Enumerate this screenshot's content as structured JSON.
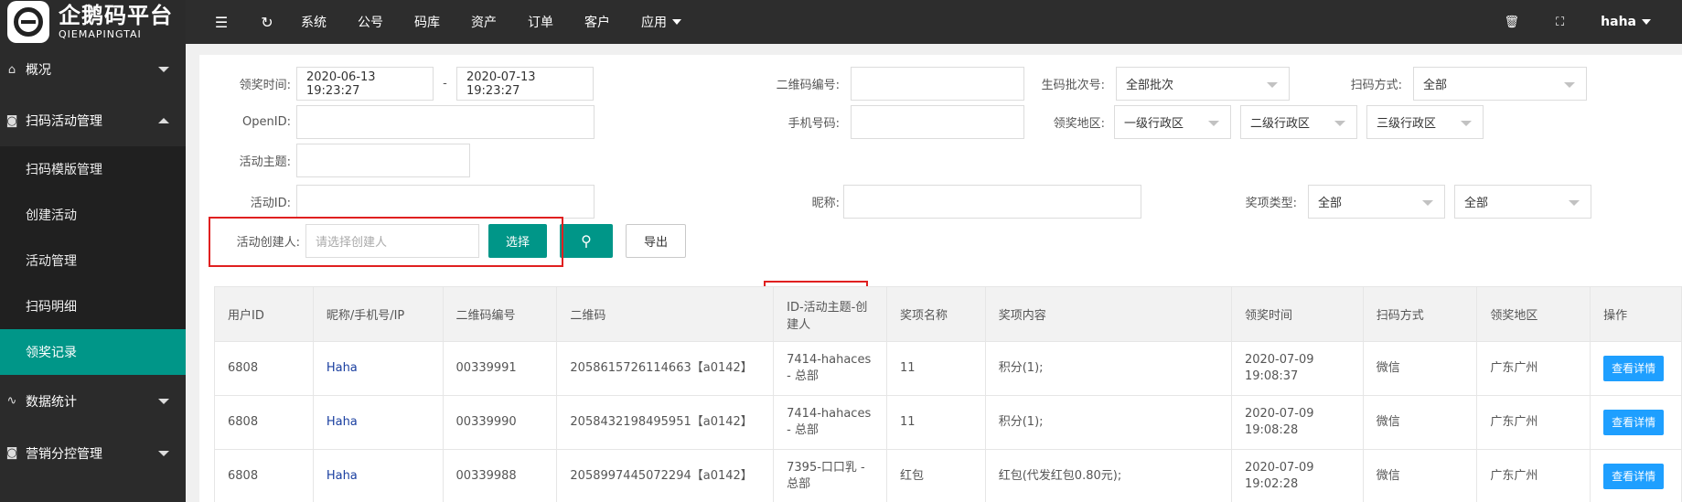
{
  "brand": {
    "name_cn": "企鹅码平台",
    "name_en": "QIEMAPINGTAI"
  },
  "sidebar": {
    "groups": [
      {
        "label": "概况",
        "icon": "home-icon"
      },
      {
        "label": "扫码活动管理",
        "icon": "camera-icon"
      },
      {
        "label": "数据统计",
        "icon": "pulse-icon"
      },
      {
        "label": "营销分控管理",
        "icon": "camera-icon"
      }
    ],
    "submenu": [
      {
        "label": "扫码模版管理"
      },
      {
        "label": "创建活动"
      },
      {
        "label": "活动管理"
      },
      {
        "label": "扫码明细"
      },
      {
        "label": "领奖记录"
      }
    ]
  },
  "topbar": {
    "nav": [
      "系统",
      "公号",
      "码库",
      "资产",
      "订单",
      "客户",
      "应用"
    ],
    "user": "haha"
  },
  "filters": {
    "award_time_label": "领奖时间:",
    "award_time_start": "2020-06-13 19:23:27",
    "award_time_sep": "-",
    "award_time_end": "2020-07-13 19:23:27",
    "qrcode_no_label": "二维码编号:",
    "batch_label": "生码批次号:",
    "batch_value": "全部批次",
    "scan_method_label": "扫码方式:",
    "scan_method_value": "全部",
    "openid_label": "OpenID:",
    "phone_label": "手机号码:",
    "region_label": "领奖地区:",
    "region1": "一级行政区",
    "region2": "二级行政区",
    "region3": "三级行政区",
    "theme_label": "活动主题:",
    "activity_id_label": "活动ID:",
    "nickname_label": "昵称:",
    "prize_type_label": "奖项类型:",
    "prize_type_value1": "全部",
    "prize_type_value2": "全部",
    "creator_label": "活动创建人:",
    "creator_placeholder": "请选择创建人",
    "select_button": "选择",
    "export_button": "导出"
  },
  "table": {
    "headers": [
      "用户ID",
      "昵称/手机号/IP",
      "二维码编号",
      "二维码",
      "ID-活动主题-创建人",
      "奖项名称",
      "奖项内容",
      "领奖时间",
      "扫码方式",
      "领奖地区",
      "操作"
    ],
    "rows": [
      {
        "user_id": "6808",
        "nick": "Haha",
        "qr_no": "00339991",
        "qr": "2058615726114663【a0142】",
        "activity": "7414-hahaces - 总部",
        "prize_name": "11",
        "prize_content": "积分(1);",
        "time": "2020-07-09 19:08:37",
        "scan": "微信",
        "region": "广东广州",
        "action": "查看详情"
      },
      {
        "user_id": "6808",
        "nick": "Haha",
        "qr_no": "00339990",
        "qr": "2058432198495951【a0142】",
        "activity": "7414-hahaces - 总部",
        "prize_name": "11",
        "prize_content": "积分(1);",
        "time": "2020-07-09 19:08:28",
        "scan": "微信",
        "region": "广东广州",
        "action": "查看详情"
      },
      {
        "user_id": "6808",
        "nick": "Haha",
        "qr_no": "00339988",
        "qr": "2058997445072294【a0142】",
        "activity": "7395-口口乳 - 总部",
        "prize_name": "红包",
        "prize_content": "红包(代发红包0.80元);",
        "time": "2020-07-09 19:02:28",
        "scan": "微信",
        "region": "广东广州",
        "action": "查看详情"
      }
    ]
  }
}
